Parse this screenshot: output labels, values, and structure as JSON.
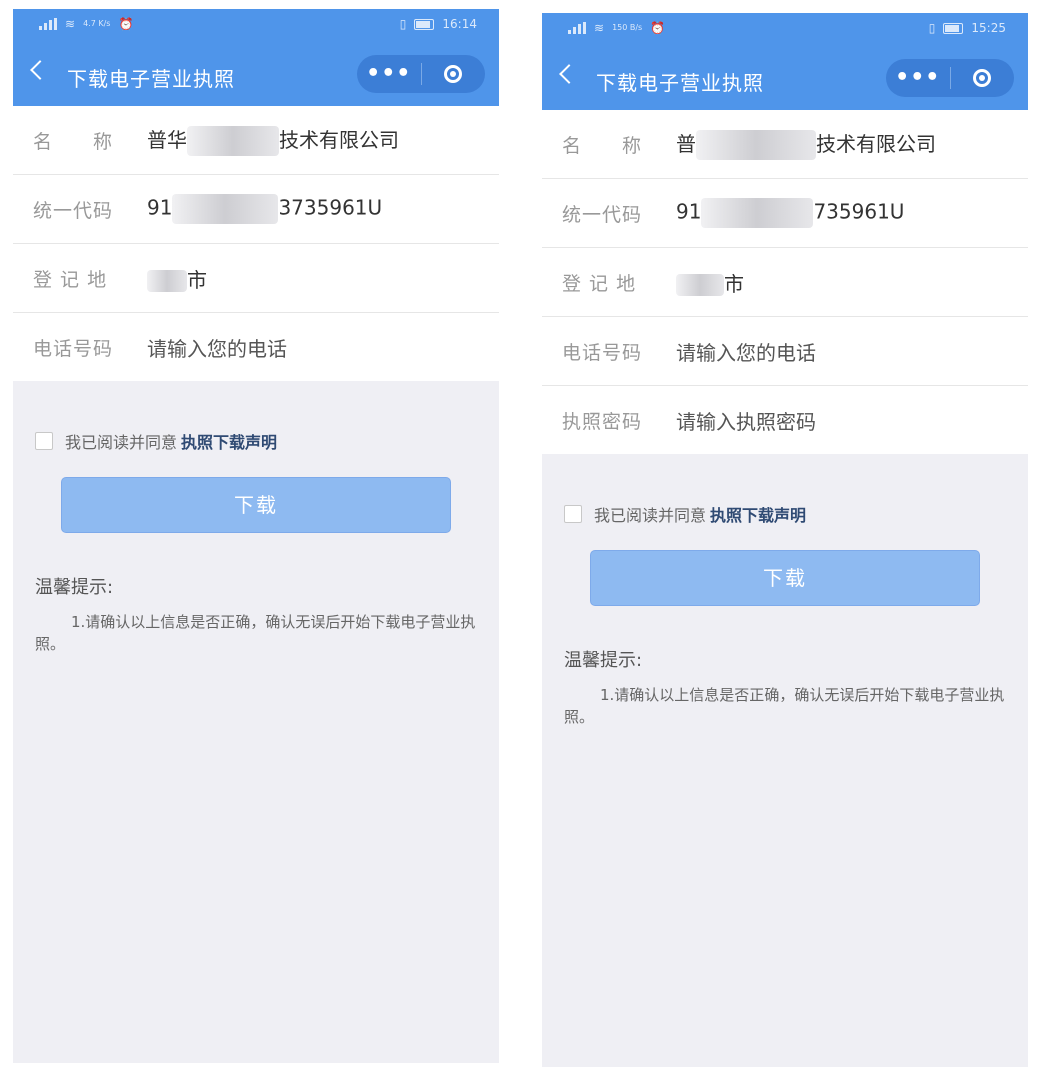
{
  "screens": [
    {
      "status": {
        "speed": "4.7 K/s",
        "time": "16:14"
      },
      "nav": {
        "title": "下载电子营业执照",
        "more": "•••"
      },
      "rows": [
        {
          "label": "名　　称",
          "value_prefix": "普华",
          "value_suffix": "技术有限公司"
        },
        {
          "label": "统一代码",
          "value_prefix": "91",
          "value_suffix": "3735961U"
        },
        {
          "label": "登 记 地",
          "value_prefix": "",
          "value_suffix": "市"
        },
        {
          "label": "电话号码",
          "placeholder": "请输入您的电话"
        }
      ],
      "agree": {
        "text": "我已阅读并同意",
        "link": "执照下载声明"
      },
      "download": "下载",
      "tips": {
        "title": "温馨提示:",
        "body": "1.请确认以上信息是否正确，确认无误后开始下载电子营业执照。"
      }
    },
    {
      "status": {
        "speed": "150 B/s",
        "time": "15:25"
      },
      "nav": {
        "title": "下载电子营业执照",
        "more": "•••"
      },
      "rows": [
        {
          "label": "名　　称",
          "value_prefix": "普",
          "value_suffix": "技术有限公司"
        },
        {
          "label": "统一代码",
          "value_prefix": "91",
          "value_suffix": "735961U"
        },
        {
          "label": "登 记 地",
          "value_prefix": "",
          "value_suffix": "市"
        },
        {
          "label": "电话号码",
          "placeholder": "请输入您的电话"
        },
        {
          "label": "执照密码",
          "placeholder": "请输入执照密码"
        }
      ],
      "agree": {
        "text": "我已阅读并同意",
        "link": "执照下载声明"
      },
      "download": "下载",
      "tips": {
        "title": "温馨提示:",
        "body": "1.请确认以上信息是否正确，确认无误后开始下载电子营业执照。"
      }
    }
  ],
  "colors": {
    "brand": "#4f95ea",
    "button": "#8ebaf1",
    "background": "#efeff4"
  }
}
